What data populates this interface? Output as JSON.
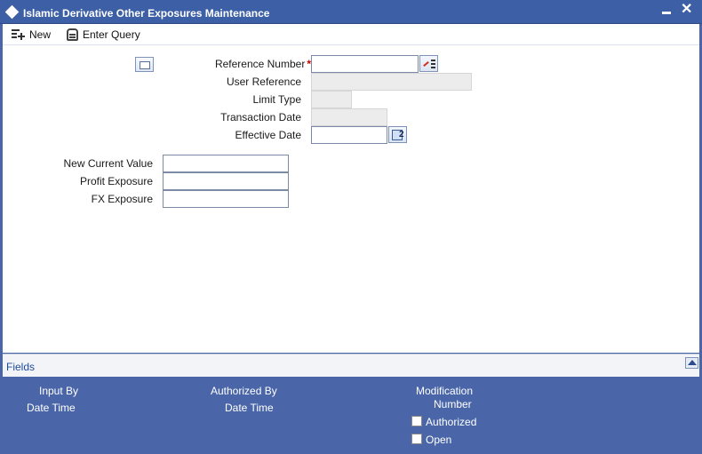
{
  "window": {
    "title": "Islamic Derivative Other Exposures Maintenance",
    "close_glyph": "✕"
  },
  "toolbar": {
    "new_label": "New",
    "enter_query_label": "Enter Query"
  },
  "form": {
    "reference_number": {
      "label": "Reference Number",
      "required_mark": "*",
      "value": ""
    },
    "user_reference": {
      "label": "User Reference",
      "value": ""
    },
    "limit_type": {
      "label": "Limit Type",
      "value": ""
    },
    "transaction_date": {
      "label": "Transaction Date",
      "value": ""
    },
    "effective_date": {
      "label": "Effective Date",
      "value": ""
    },
    "new_current_value": {
      "label": "New Current Value",
      "value": ""
    },
    "profit_exposure": {
      "label": "Profit Exposure",
      "value": ""
    },
    "fx_exposure": {
      "label": "FX Exposure",
      "value": ""
    }
  },
  "fields_bar": {
    "label": "Fields"
  },
  "footer": {
    "input_by": "Input By",
    "input_date_time": "Date Time",
    "authorized_by": "Authorized By",
    "authorized_date_time": "Date Time",
    "modification_line1": "Modification",
    "modification_line2": "Number",
    "authorized_checkbox_label": "Authorized",
    "open_checkbox_label": "Open"
  },
  "icons": {
    "title": "diamond-icon",
    "minimize": "minimize-icon",
    "close": "close-icon",
    "new": "new-document-icon",
    "enter_query": "query-icon",
    "lov": "list-of-values-icon",
    "calendar": "calendar-icon",
    "scroll": "scroll-up-icon"
  },
  "colors": {
    "titlebar": "#3c5fa6",
    "footer": "#4a66a8",
    "required": "#cc0000",
    "link": "#1f4a9c"
  }
}
